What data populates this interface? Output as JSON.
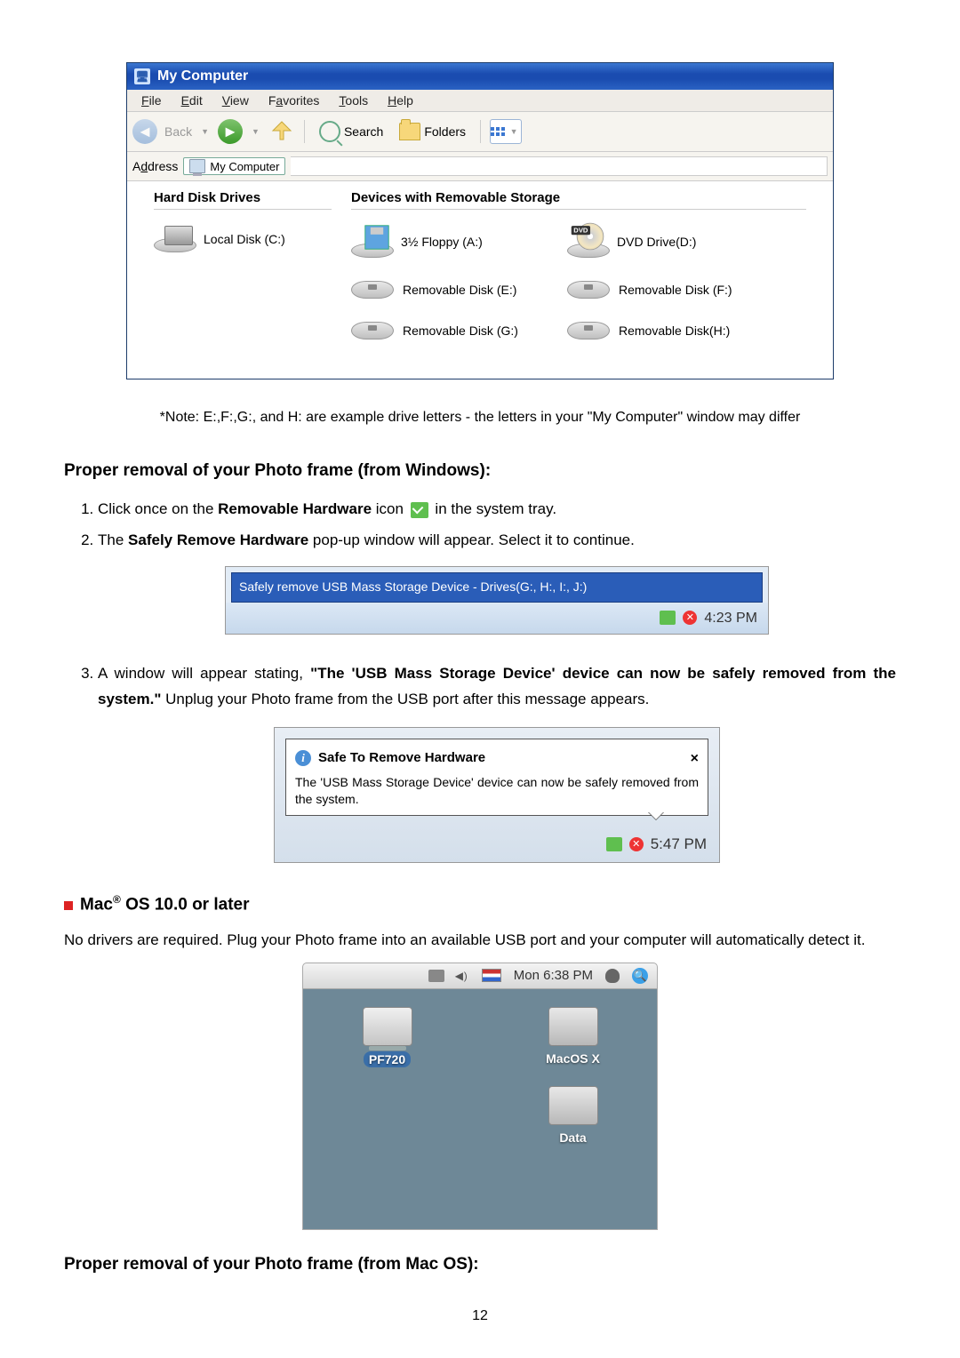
{
  "mycomputer": {
    "title": "My Computer",
    "menus": [
      "File",
      "Edit",
      "View",
      "Favorites",
      "Tools",
      "Help"
    ],
    "menu_underline_idx": [
      0,
      0,
      0,
      1,
      0,
      0
    ],
    "back": "Back",
    "search": "Search",
    "folders": "Folders",
    "address_label": "Address",
    "address_value": "My Computer",
    "hdd_header": "Hard Disk Drives",
    "removable_header": "Devices with Removable Storage",
    "local_disk": "Local Disk (C:)",
    "floppy": "3½ Floppy (A:)",
    "dvd": "DVD Drive(D:)",
    "dvd_badge": "DVD",
    "rem_e": "Removable Disk (E:)",
    "rem_f": "Removable Disk (F:)",
    "rem_g": "Removable Disk (G:)",
    "rem_h": "Removable Disk(H:)"
  },
  "note": "*Note: E:,F:,G:, and H: are example drive letters - the letters in your \"My Computer\" window may differ",
  "h_win": "Proper removal of your Photo frame (from Windows):",
  "step1_a": "Click once on the ",
  "step1_b": "Removable Hardware",
  "step1_c": " icon ",
  "step1_d": " in the system tray.",
  "step2_a": "The ",
  "step2_b": "Safely Remove Hardware",
  "step2_c": " pop-up window will appear. Select it to continue.",
  "sr_menu": "Safely remove USB Mass Storage Device - Drives(G:, H:, I:, J:)",
  "sr_time": "4:23 PM",
  "step3_a": "A window will appear stating, ",
  "step3_b": "\"The 'USB Mass Storage Device' device can now be safely removed from the system.\"",
  "step3_c": " Unplug your Photo frame from the USB port after this message appears.",
  "balloon_title": "Safe To Remove Hardware",
  "balloon_body": "The 'USB Mass Storage Device' device can now be safely removed from the system.",
  "balloon_close": "×",
  "balloon_time": "5:47 PM",
  "mac_header_a": "Mac",
  "mac_header_b": " OS 10.0 or later",
  "mac_reg": "®",
  "mac_body": "No drivers are required. Plug your Photo frame into an available USB port and your computer will automatically detect it.",
  "macbar_time": "Mon 6:38 PM",
  "mac_drive1": "PF720",
  "mac_drive2": "MacOS X",
  "mac_drive3": "Data",
  "h_mac": "Proper removal of your Photo frame (from Mac OS):",
  "page_number": "12"
}
